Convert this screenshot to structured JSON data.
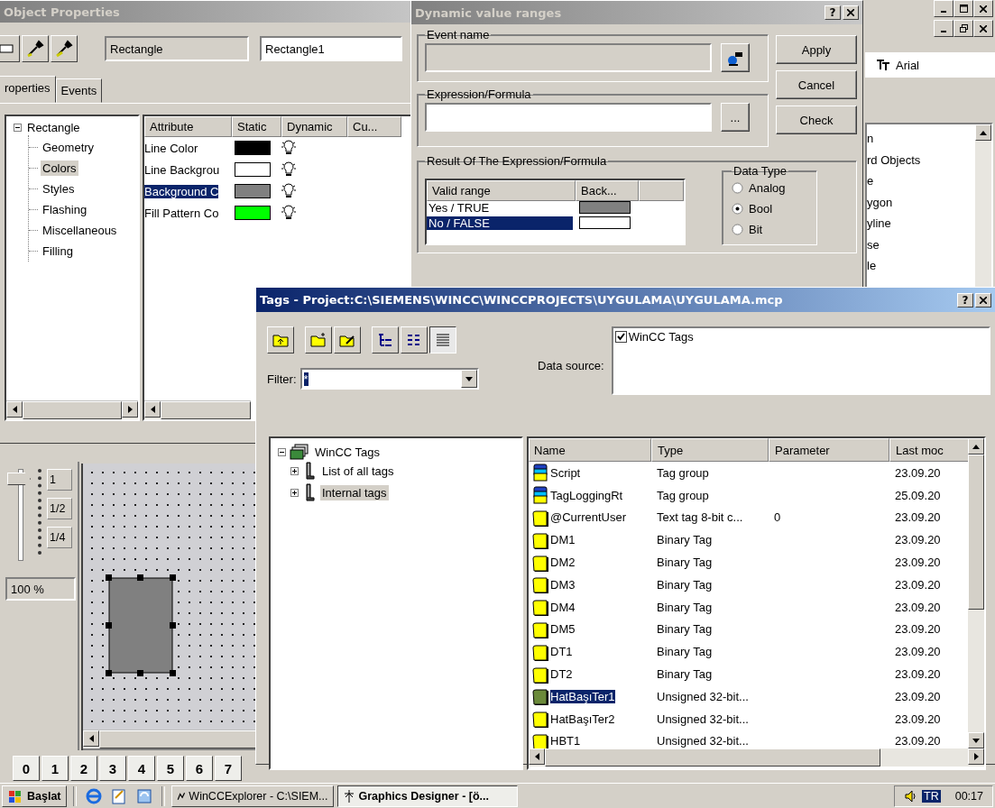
{
  "object_properties": {
    "title": "Object Properties",
    "object_type": "Rectangle",
    "object_name": "Rectangle1",
    "tabs": [
      {
        "label": "roperties",
        "selected": true
      },
      {
        "label": "Events",
        "selected": false
      }
    ],
    "tree": {
      "label": "Rectangle",
      "expanded": true,
      "children": [
        {
          "label": "Geometry",
          "selected": false
        },
        {
          "label": "Colors",
          "selected": true
        },
        {
          "label": "Styles",
          "selected": false
        },
        {
          "label": "Flashing",
          "selected": false
        },
        {
          "label": "Miscellaneous",
          "selected": false
        },
        {
          "label": "Filling",
          "selected": false
        }
      ]
    },
    "columns": [
      "Attribute",
      "Static",
      "Dynamic",
      "Cu..."
    ],
    "rows": [
      {
        "attribute": "Line Color",
        "color": "#000000",
        "selected": false
      },
      {
        "attribute": "Line Backgrou",
        "color": "#ffffff",
        "selected": false
      },
      {
        "attribute": "Background C",
        "color": "#808080",
        "selected": true
      },
      {
        "attribute": "Fill Pattern Co",
        "color": "#00ff00",
        "selected": false
      }
    ]
  },
  "dynamic_dialog": {
    "title": "Dynamic value ranges",
    "help_button": "?",
    "event_name_label": "Event name",
    "expression_label": "Expression/Formula",
    "browse_button": "...",
    "buttons": [
      "Apply",
      "Cancel",
      "Check"
    ],
    "result_label": "Result Of The Expression/Formula",
    "result_columns": [
      "Valid range",
      "Back..."
    ],
    "results": [
      {
        "range": "Yes / TRUE",
        "color": "#808080",
        "selected": false
      },
      {
        "range": "No / FALSE",
        "color": "#ffffff",
        "selected": true
      }
    ],
    "data_type_label": "Data Type",
    "data_types": [
      {
        "label": "Analog",
        "selected": false
      },
      {
        "label": "Bool",
        "selected": true
      },
      {
        "label": "Bit",
        "selected": false
      }
    ]
  },
  "background_panel": {
    "font": "Arial",
    "objects": [
      "n",
      "rd Objects",
      "e",
      "ygon",
      "yline",
      "se",
      "le"
    ]
  },
  "designer": {
    "zoom_levels": [
      "1",
      "1/2",
      "1/4"
    ],
    "zoom": "100 %",
    "layers": [
      "0",
      "1",
      "2",
      "3",
      "4",
      "5",
      "6",
      "7"
    ]
  },
  "tags_window": {
    "title": "Tags - Project:C:\\SIEMENS\\WINCC\\WINCCPROJECTS\\UYGULAMA\\UYGULAMA.mcp",
    "help_button": "?",
    "filter_label": "Filter:",
    "filter_value": "*",
    "data_source_label": "Data source:",
    "data_sources": [
      {
        "label": "WinCC Tags",
        "checked": true
      }
    ],
    "tree": {
      "label": "WinCC Tags",
      "expanded": true,
      "children": [
        {
          "label": "List of all tags",
          "expanded": false,
          "selected": false
        },
        {
          "label": "Internal tags",
          "expanded": false,
          "selected": true
        }
      ]
    },
    "columns": [
      "Name",
      "Type",
      "Parameter",
      "Last moc"
    ],
    "rows": [
      {
        "kind": "group",
        "name": "Script",
        "type": "Tag group",
        "modified": "23.09.20",
        "selected": false
      },
      {
        "kind": "group",
        "name": "TagLoggingRt",
        "type": "Tag group",
        "modified": "25.09.20",
        "selected": false
      },
      {
        "kind": "tag",
        "name": "@CurrentUser",
        "type": "Text tag 8-bit c...",
        "parameter": "0",
        "modified": "23.09.20",
        "selected": false
      },
      {
        "kind": "tag",
        "name": "DM1",
        "type": "Binary Tag",
        "modified": "23.09.20",
        "selected": false
      },
      {
        "kind": "tag",
        "name": "DM2",
        "type": "Binary Tag",
        "modified": "23.09.20",
        "selected": false
      },
      {
        "kind": "tag",
        "name": "DM3",
        "type": "Binary Tag",
        "modified": "23.09.20",
        "selected": false
      },
      {
        "kind": "tag",
        "name": "DM4",
        "type": "Binary Tag",
        "modified": "23.09.20",
        "selected": false
      },
      {
        "kind": "tag",
        "name": "DM5",
        "type": "Binary Tag",
        "modified": "23.09.20",
        "selected": false
      },
      {
        "kind": "tag",
        "name": "DT1",
        "type": "Binary Tag",
        "modified": "23.09.20",
        "selected": false
      },
      {
        "kind": "tag",
        "name": "DT2",
        "type": "Binary Tag",
        "modified": "23.09.20",
        "selected": false
      },
      {
        "kind": "tag",
        "name": "HatBaşıTer1",
        "type": "Unsigned 32-bit...",
        "modified": "23.09.20",
        "selected": true
      },
      {
        "kind": "tag",
        "name": "HatBaşıTer2",
        "type": "Unsigned 32-bit...",
        "modified": "23.09.20",
        "selected": false
      },
      {
        "kind": "tag",
        "name": "HBT1",
        "type": "Unsigned 32-bit...",
        "modified": "23.09.20",
        "selected": false
      }
    ]
  },
  "taskbar": {
    "start": "Başlat",
    "tasks": [
      {
        "label": "WinCCExplorer - C:\\SIEM...",
        "selected": false
      },
      {
        "label": "Graphics Designer - [ö...",
        "selected": true
      }
    ],
    "language": "TR",
    "clock": "00:17"
  }
}
